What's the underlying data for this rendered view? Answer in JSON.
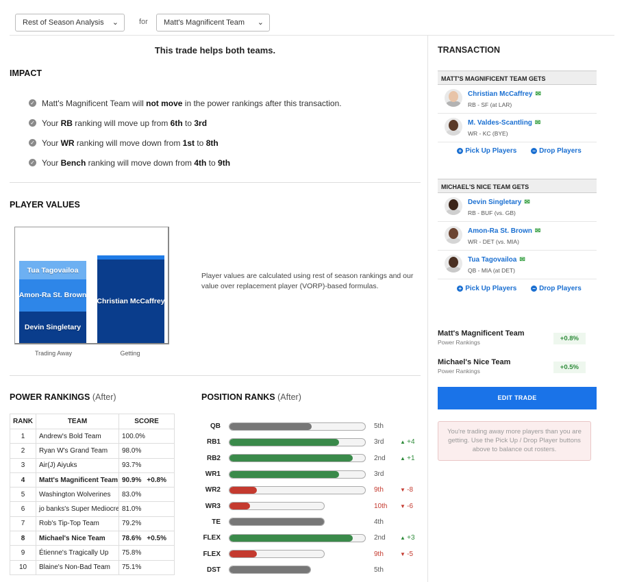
{
  "topbar": {
    "analysis_select": "Rest of Season Analysis",
    "for_label": "for",
    "team_select": "Matt's Magnificent Team"
  },
  "headline": "This trade helps both teams.",
  "impact": {
    "title": "IMPACT",
    "items": [
      {
        "pre": "Matt's Magnificent Team will ",
        "b1": "not move",
        "mid": " in the power rankings after this transaction.",
        "b2": "",
        "post": "",
        "b3": ""
      },
      {
        "pre": "Your ",
        "b1": "RB",
        "mid": " ranking will move up from ",
        "b2": "6th",
        "post": " to ",
        "b3": "3rd"
      },
      {
        "pre": "Your ",
        "b1": "WR",
        "mid": " ranking will move down from ",
        "b2": "1st",
        "post": " to ",
        "b3": "8th"
      },
      {
        "pre": "Your ",
        "b1": "Bench",
        "mid": " ranking will move down from ",
        "b2": "4th",
        "post": " to ",
        "b3": "9th"
      }
    ]
  },
  "player_values": {
    "title": "PLAYER VALUES",
    "trading_away_label": "Trading Away",
    "getting_label": "Getting",
    "description": "Player values are calculated using rest of season rankings and our value over replacement player (VORP)-based formulas.",
    "trading_away": [
      {
        "name": "Devin Singletary",
        "value": 49,
        "color": "#0a3d8c"
      },
      {
        "name": "Amon-Ra St. Brown",
        "value": 50,
        "color": "#2e86e8"
      },
      {
        "name": "Tua Tagovailoa",
        "value": 28,
        "color": "#6db0f2"
      }
    ],
    "getting": [
      {
        "name": "Christian McCaffrey",
        "value": 130,
        "color": "#0a3d8c",
        "cap": "#1f7be6"
      }
    ],
    "max": 170
  },
  "power_rankings": {
    "title": "POWER RANKINGS",
    "after": "(After)",
    "headers": [
      "RANK",
      "TEAM",
      "SCORE"
    ],
    "rows": [
      {
        "rank": "1",
        "team": "Andrew's Bold Team",
        "score": "100.0%",
        "change": "",
        "bold": false
      },
      {
        "rank": "2",
        "team": "Ryan W's Grand Team",
        "score": "98.0%",
        "change": "",
        "bold": false
      },
      {
        "rank": "3",
        "team": "Air(J) Aiyuks",
        "score": "93.7%",
        "change": "",
        "bold": false
      },
      {
        "rank": "4",
        "team": "Matt's Magnificent Team",
        "score": "90.9%",
        "change": "+0.8%",
        "bold": true
      },
      {
        "rank": "5",
        "team": "Washington Wolverines",
        "score": "83.0%",
        "change": "",
        "bold": false
      },
      {
        "rank": "6",
        "team": "jo banks's Super Mediocre",
        "score": "81.0%",
        "change": "",
        "bold": false
      },
      {
        "rank": "7",
        "team": "Rob's Tip-Top Team",
        "score": "79.2%",
        "change": "",
        "bold": false
      },
      {
        "rank": "8",
        "team": "Michael's Nice Team",
        "score": "78.6%",
        "change": "+0.5%",
        "bold": true
      },
      {
        "rank": "9",
        "team": "Étienne's Tragically Up",
        "score": "75.8%",
        "change": "",
        "bold": false
      },
      {
        "rank": "10",
        "team": "Blaine's Non-Bad Team",
        "score": "75.1%",
        "change": "",
        "bold": false
      }
    ]
  },
  "position_ranks": {
    "title": "POSITION RANKS",
    "after": "(After)",
    "rows": [
      {
        "pos": "QB",
        "fill": 0.6,
        "track": 1.0,
        "color": "#777777",
        "rank": "5th",
        "change": "",
        "dir": ""
      },
      {
        "pos": "RB1",
        "fill": 0.8,
        "track": 1.0,
        "color": "#3a8a4a",
        "rank": "3rd",
        "change": "+4",
        "dir": "up"
      },
      {
        "pos": "RB2",
        "fill": 0.9,
        "track": 1.0,
        "color": "#3a8a4a",
        "rank": "2nd",
        "change": "+1",
        "dir": "up"
      },
      {
        "pos": "WR1",
        "fill": 0.8,
        "track": 1.0,
        "color": "#3a8a4a",
        "rank": "3rd",
        "change": "",
        "dir": ""
      },
      {
        "pos": "WR2",
        "fill": 0.2,
        "track": 1.0,
        "color": "#c43a2f",
        "rank": "9th",
        "change": "-8",
        "dir": "down"
      },
      {
        "pos": "WR3",
        "fill": 0.15,
        "track": 0.7,
        "color": "#c43a2f",
        "rank": "10th",
        "change": "-6",
        "dir": "down"
      },
      {
        "pos": "TE",
        "fill": 0.7,
        "track": 0.7,
        "color": "#777777",
        "rank": "4th",
        "change": "",
        "dir": ""
      },
      {
        "pos": "FLEX",
        "fill": 0.9,
        "track": 1.0,
        "color": "#3a8a4a",
        "rank": "2nd",
        "change": "+3",
        "dir": "up"
      },
      {
        "pos": "FLEX",
        "fill": 0.2,
        "track": 0.7,
        "color": "#c43a2f",
        "rank": "9th",
        "change": "-5",
        "dir": "down"
      },
      {
        "pos": "DST",
        "fill": 0.6,
        "track": 0.6,
        "color": "#777777",
        "rank": "5th",
        "change": "",
        "dir": ""
      }
    ]
  },
  "transaction": {
    "title": "TRANSACTION",
    "team1_header": "MATT'S MAGNIFICENT TEAM GETS",
    "team1_players": [
      {
        "name": "Christian McCaffrey",
        "info": "RB - SF (at LAR)",
        "skin": "#e8c4a8",
        "jersey": "#b3b3b3"
      },
      {
        "name": "M. Valdes-Scantling",
        "info": "WR - KC (BYE)",
        "skin": "#5a3a28",
        "jersey": "#d9d9d9"
      }
    ],
    "team2_header": "MICHAEL'S NICE TEAM GETS",
    "team2_players": [
      {
        "name": "Devin Singletary",
        "info": "RB - BUF (vs. GB)",
        "skin": "#3b2419",
        "jersey": "#cfcfcf"
      },
      {
        "name": "Amon-Ra St. Brown",
        "info": "WR - DET (vs. MIA)",
        "skin": "#6b4431",
        "jersey": "#d5d5d5"
      },
      {
        "name": "Tua Tagovailoa",
        "info": "QB - MIA (at DET)",
        "skin": "#4a3022",
        "jersey": "#c9c9c9"
      }
    ],
    "pick_up": "Pick Up Players",
    "drop": "Drop Players",
    "summary": [
      {
        "team": "Matt's Magnificent Team",
        "sub": "Power Rankings",
        "change": "+0.8%"
      },
      {
        "team": "Michael's Nice Team",
        "sub": "Power Rankings",
        "change": "+0.5%"
      }
    ],
    "edit_trade": "EDIT TRADE",
    "warning": "You're trading away more players than you are getting. Use the Pick Up / Drop Player buttons above to balance out rosters."
  }
}
